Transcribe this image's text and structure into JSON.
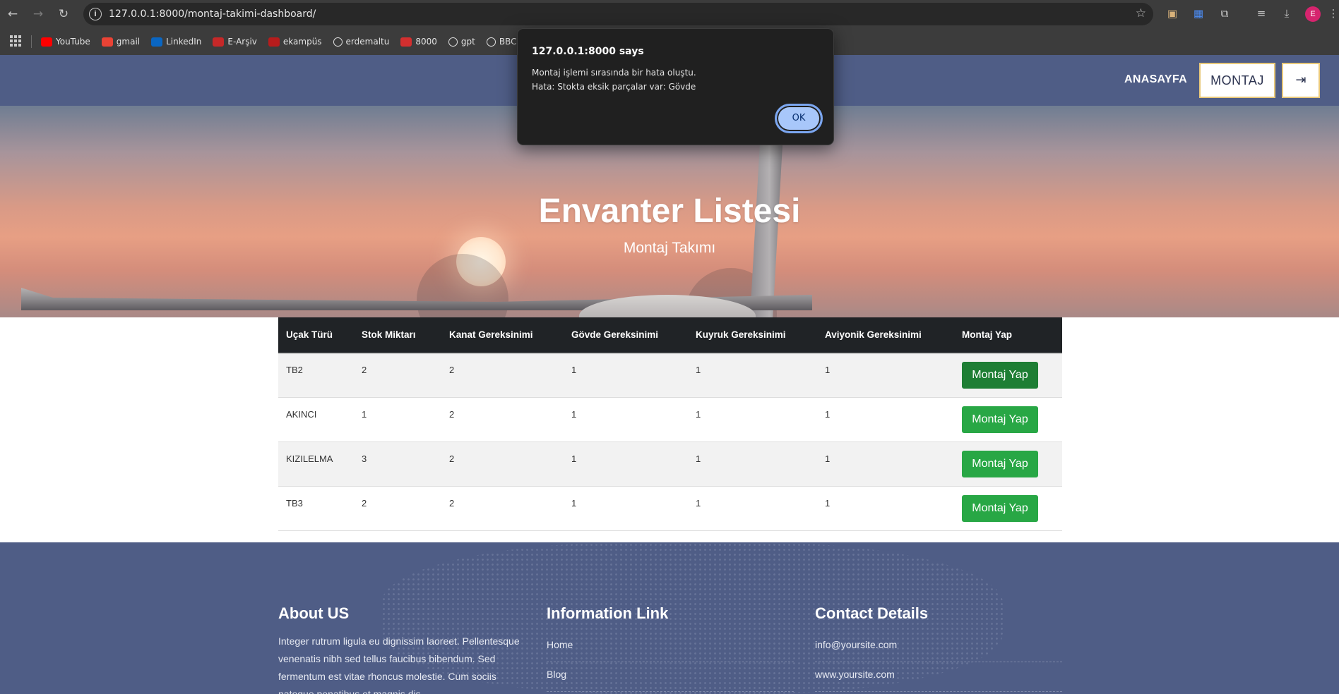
{
  "browser": {
    "url": "127.0.0.1:8000/montaj-takimi-dashboard/",
    "profile_initial": "E",
    "bookmarks": [
      {
        "label": "YouTube",
        "icon": "youtube-icon",
        "color": "#ff0000"
      },
      {
        "label": "gmail",
        "icon": "gmail-icon",
        "color": "#ea4335"
      },
      {
        "label": "LinkedIn",
        "icon": "linkedin-icon",
        "color": "#0a66c2"
      },
      {
        "label": "E-Arşiv",
        "icon": "e-arsiv-icon",
        "color": "#c62828"
      },
      {
        "label": "ekampüs",
        "icon": "ekampus-icon",
        "color": "#b71c1c"
      },
      {
        "label": "erdemaltu",
        "icon": "github-icon",
        "color": "#ffffff"
      },
      {
        "label": "8000",
        "icon": "django-icon",
        "color": "#d32f2f"
      },
      {
        "label": "gpt",
        "icon": "openai-icon",
        "color": "#ffffff"
      },
      {
        "label": "BBC",
        "icon": "bbc-icon",
        "color": "#ffffff"
      }
    ]
  },
  "dialog": {
    "title": "127.0.0.1:8000 says",
    "line1": "Montaj işlemi sırasında bir hata oluştu.",
    "line2": "Hata: Stokta eksik parçalar var: Gövde",
    "ok_label": "OK"
  },
  "header": {
    "home_label": "ANASAYFA",
    "montaj_label": "MONTAJ"
  },
  "hero": {
    "title": "Envanter Listesi",
    "subtitle": "Montaj Takımı"
  },
  "table": {
    "headers": [
      "Uçak Türü",
      "Stok Miktarı",
      "Kanat Gereksinimi",
      "Gövde Gereksinimi",
      "Kuyruk Gereksinimi",
      "Aviyonik Gereksinimi",
      "Montaj Yap"
    ],
    "rows": [
      {
        "type": "TB2",
        "stock": "2",
        "wing": "2",
        "body": "1",
        "tail": "1",
        "avionics": "1",
        "action": "Montaj Yap"
      },
      {
        "type": "AKINCI",
        "stock": "1",
        "wing": "2",
        "body": "1",
        "tail": "1",
        "avionics": "1",
        "action": "Montaj Yap"
      },
      {
        "type": "KIZILELMA",
        "stock": "3",
        "wing": "2",
        "body": "1",
        "tail": "1",
        "avionics": "1",
        "action": "Montaj Yap"
      },
      {
        "type": "TB3",
        "stock": "2",
        "wing": "2",
        "body": "1",
        "tail": "1",
        "avionics": "1",
        "action": "Montaj Yap"
      }
    ]
  },
  "footer": {
    "about": {
      "title": "About US",
      "text": "Integer rutrum ligula eu dignissim laoreet. Pellentesque venenatis nibh sed tellus faucibus bibendum. Sed fermentum est vitae rhoncus molestie. Cum sociis natoque penatibus et magnis dis"
    },
    "links": {
      "title": "Information Link",
      "items": [
        "Home",
        "Blog"
      ]
    },
    "contact": {
      "title": "Contact Details",
      "items": [
        "info@yoursite.com",
        "www.yoursite.com"
      ]
    }
  },
  "colors": {
    "header_bg": "#4f5d86",
    "table_head_bg": "#202326",
    "button_green": "#28a745",
    "dialog_bg": "#202020",
    "ok_button": "#a8c7fa"
  }
}
